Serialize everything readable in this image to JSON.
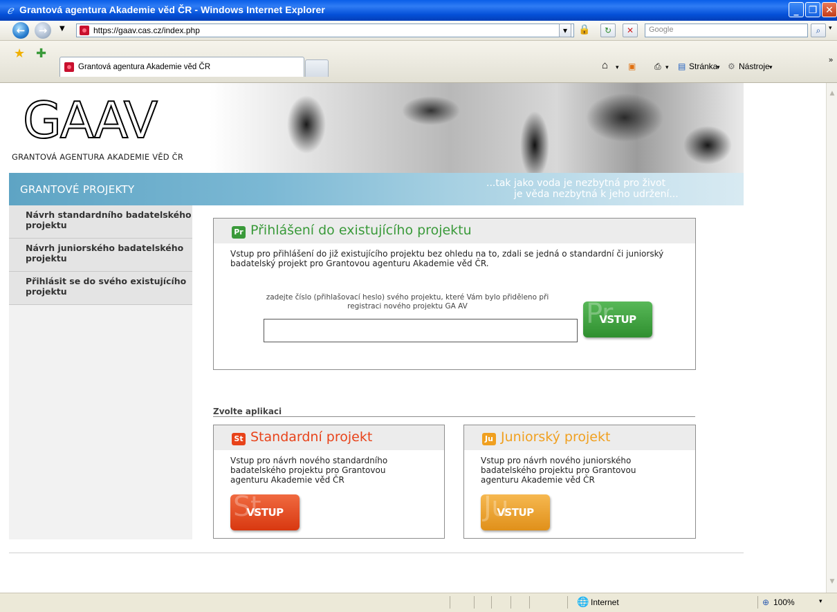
{
  "window": {
    "title": "Grantová agentura Akademie věd ČR - Windows Internet Explorer",
    "controls": {
      "minimize": "_",
      "maximize": "❐",
      "close": "✕"
    }
  },
  "address_bar": {
    "url": "https://gaav.cas.cz/index.php",
    "search_placeholder": "Google"
  },
  "tabs": [
    {
      "label": "Grantová agentura Akademie věd ČR"
    }
  ],
  "command_bar": {
    "page_label": "Stránka",
    "tools_label": "Nástroje"
  },
  "header": {
    "logo_text": "GAAV",
    "org_name": "GRANTOVÁ AGENTURA AKADEMIE VĚD ČR",
    "section_label": "GRANTOVÉ PROJEKTY",
    "quote_line1": "...tak jako voda je nezbytná pro život",
    "quote_line2": "je věda nezbytná k jeho udržení..."
  },
  "sidebar": {
    "items": [
      {
        "label": "Návrh standardního badatelského projektu"
      },
      {
        "label": "Návrh juniorského badatelského projektu"
      },
      {
        "label": "Přihlásit se do svého existujícího projektu"
      }
    ]
  },
  "login_panel": {
    "badge": "Pr",
    "title": "Přihlášení do existujícího projektu",
    "description": "Vstup pro přihlášení do již existujícího projektu bez ohledu na to, zdali se jedná o standardní či juniorský badatelský projekt pro Grantovou agenturu Akademie věd ČR.",
    "hint": "zadejte číslo (přihlašovací heslo) svého projektu, které Vám bylo přiděleno při registraci nového projektu GA AV",
    "input_value": "",
    "button_label": "VSTUP",
    "button_ghost": "Pr"
  },
  "apps": {
    "heading": "Zvolte aplikaci",
    "items": [
      {
        "badge": "St",
        "title": "Standardní projekt",
        "description": "Vstup pro návrh nového standardního badatelského projektu pro Grantovou agenturu Akademie věd ČR",
        "button_label": "VSTUP",
        "button_ghost": "St"
      },
      {
        "badge": "Ju",
        "title": "Juniorský projekt",
        "description": "Vstup pro návrh nového juniorského badatelského projektu pro Grantovou agenturu Akademie věd ČR",
        "button_label": "VSTUP",
        "button_ghost": "Ju"
      }
    ]
  },
  "status_bar": {
    "zone": "Internet",
    "zoom": "100%"
  },
  "colors": {
    "green": "#3a9a3a",
    "red": "#e8431a",
    "orange": "#f0a020",
    "blue_bar": "#6aaed0"
  }
}
